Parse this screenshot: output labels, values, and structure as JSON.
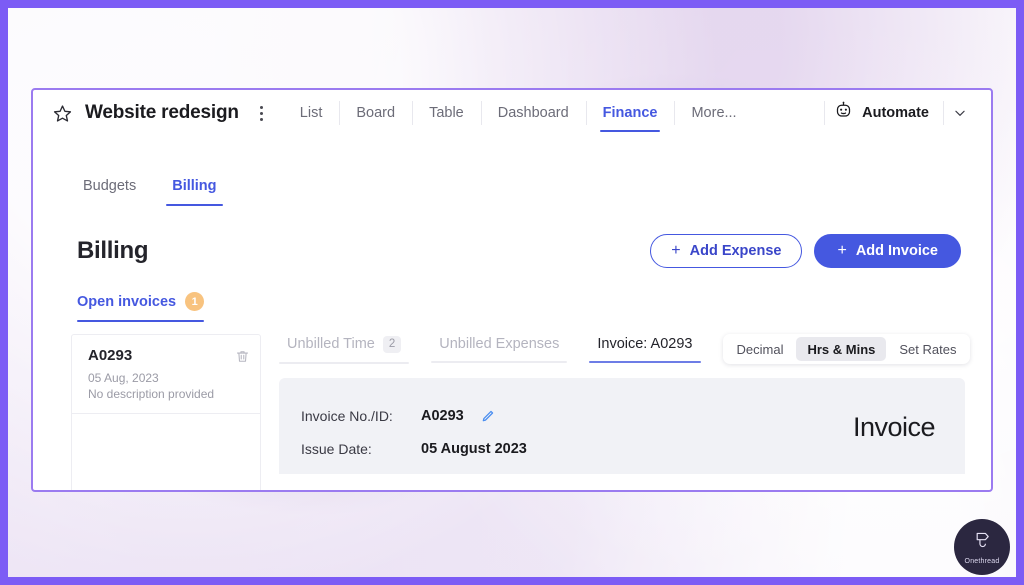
{
  "window": {
    "project_title": "Website redesign",
    "star_icon": "star-icon",
    "kebab_icon": "more-options-icon",
    "nav": [
      {
        "label": "List",
        "active": false
      },
      {
        "label": "Board",
        "active": false
      },
      {
        "label": "Table",
        "active": false
      },
      {
        "label": "Dashboard",
        "active": false
      },
      {
        "label": "Finance",
        "active": true
      },
      {
        "label": "More...",
        "active": false
      }
    ],
    "automate": {
      "label": "Automate",
      "icon": "robot-icon"
    },
    "chevron_icon": "chevron-down-icon"
  },
  "subtabs": [
    {
      "label": "Budgets",
      "active": false
    },
    {
      "label": "Billing",
      "active": true
    }
  ],
  "billing": {
    "title": "Billing",
    "add_expense_label": "Add Expense",
    "add_invoice_label": "Add Invoice",
    "plus_glyph": "+"
  },
  "invoice_tabs": [
    {
      "label": "Open invoices",
      "count": "1",
      "active": true
    }
  ],
  "invoice_list": [
    {
      "id": "A0293",
      "date": "05 Aug, 2023",
      "description": "No description provided",
      "delete_icon": "trash-icon"
    }
  ],
  "detail_tabs": [
    {
      "label": "Unbilled Time",
      "badge": "2",
      "active": false
    },
    {
      "label": "Unbilled Expenses",
      "badge": "",
      "active": false
    },
    {
      "label": "Invoice: A0293",
      "badge": "",
      "active": true
    }
  ],
  "segmented": [
    {
      "label": "Decimal",
      "active": false
    },
    {
      "label": "Hrs & Mins",
      "active": true
    },
    {
      "label": "Set Rates",
      "active": false
    }
  ],
  "invoice_sheet": {
    "heading": "Invoice",
    "fields": [
      {
        "label": "Invoice No./ID:",
        "value": "A0293",
        "editable": true
      },
      {
        "label": "Issue Date:",
        "value": "05 August 2023",
        "editable": false
      }
    ],
    "edit_icon": "pencil-icon"
  },
  "watermark": {
    "text": "Onethread",
    "icon": "onethread-logo-icon"
  },
  "colors": {
    "accent_blue": "#4558e0",
    "frame_purple": "#7c5cf5",
    "card_border_purple": "#9b7bf0",
    "badge_orange": "#f8c37f",
    "sheet_gray": "#f1f2f6"
  }
}
